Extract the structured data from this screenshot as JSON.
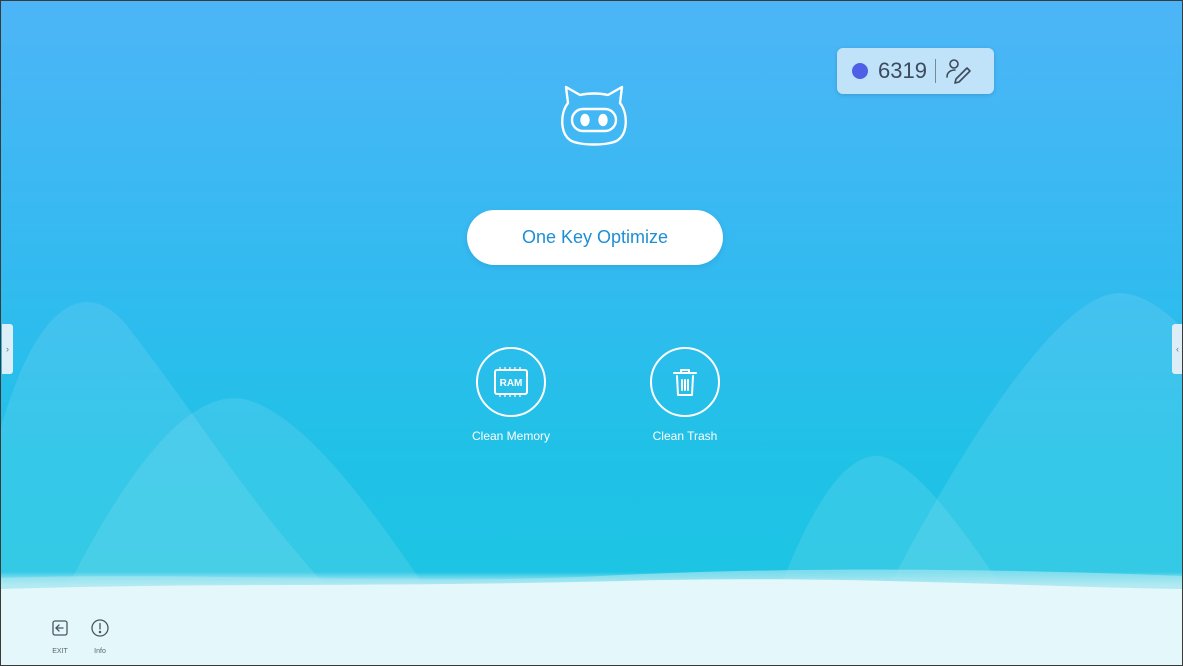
{
  "score": {
    "value": "6319",
    "dot_color": "#4f5fe6"
  },
  "mascot": {
    "icon": "robot-cat-icon"
  },
  "actions": {
    "optimize_label": "One Key Optimize"
  },
  "tools": [
    {
      "label": "Clean Memory",
      "icon": "ram-chip-icon",
      "icon_text": "RAM"
    },
    {
      "label": "Clean Trash",
      "icon": "trash-icon"
    }
  ],
  "side_handles": {
    "left": "›",
    "right": "‹"
  },
  "bottom": {
    "exit_label": "EXIT",
    "info_label": "Info"
  },
  "colors": {
    "sky_top": "#4db5f7",
    "sky_bottom": "#1ec4e4",
    "ground": "#e4f7fa",
    "accent_text": "#1d8fd4"
  }
}
